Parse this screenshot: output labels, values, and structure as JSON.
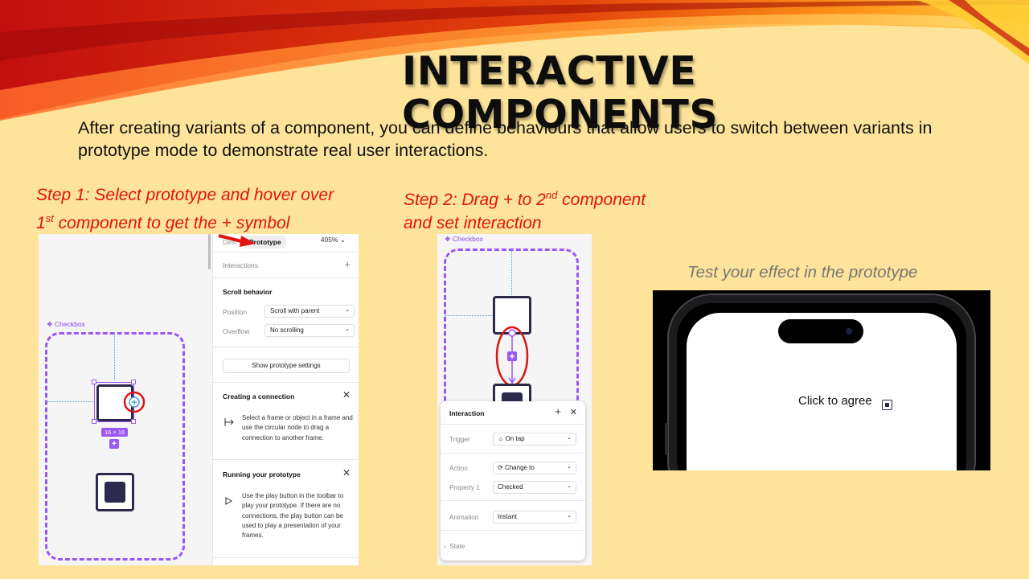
{
  "slide": {
    "title": "INTERACTIVE COMPONENTS",
    "body": "After creating variants of a component, you can define behaviours that allow users to switch between variants in prototype mode to demonstrate real user interactions.",
    "step1": {
      "line1": "Step 1: Select prototype and hover over",
      "line2_num": "1",
      "line2_sup": "st",
      "line2_rest": " component to get the + symbol"
    },
    "step2": {
      "line1_pre": "Step 2: Drag + to 2",
      "line1_sup": "nd",
      "line1_post": " component",
      "line2": "and set interaction"
    },
    "test_caption": "Test your effect in the prototype"
  },
  "screenshot1": {
    "tab_design": "Desi",
    "tab_prototype": "Prototype",
    "zoom": "405%",
    "interactions_label": "Interactions",
    "scroll_behavior": "Scroll behavior",
    "position_label": "Position",
    "position_value": "Scroll with parent",
    "overflow_label": "Overflow",
    "overflow_value": "No scrolling",
    "show_settings": "Show prototype settings",
    "creating_title": "Creating a connection",
    "creating_text": "Select a frame or object in a frame and use the circular node to drag a connection to another frame.",
    "running_title": "Running your prototype",
    "running_text": "Use the play button in the toolbar to play your prototype. If there are no connections, the play button can be used to play a presentation of your frames.",
    "component_label": "Checkbox",
    "size_badge": "16 × 16",
    "plus_badge": "+",
    "add_glyph": "+"
  },
  "screenshot2": {
    "component_label": "Checkbox",
    "panel_title": "Interaction",
    "trigger_label": "Trigger",
    "trigger_value": "On tap",
    "action_label": "Action",
    "action_value": "Change to",
    "property_label": "Property 1",
    "property_value": "Checked",
    "animation_label": "Animation",
    "animation_value": "Instant",
    "state_label": "State"
  },
  "prototype": {
    "agree_text": "Click to agree"
  },
  "colors": {
    "background": "#fde49a",
    "accent_red": "#e0140f",
    "figma_purple": "#9b57f5",
    "checkbox_navy": "#2b2a4c"
  },
  "icons": [
    "add-icon",
    "close-icon",
    "connection-icon",
    "play-icon",
    "chevron-down-icon",
    "component-icon",
    "tap-icon",
    "swap-icon",
    "arrow-icon"
  ]
}
